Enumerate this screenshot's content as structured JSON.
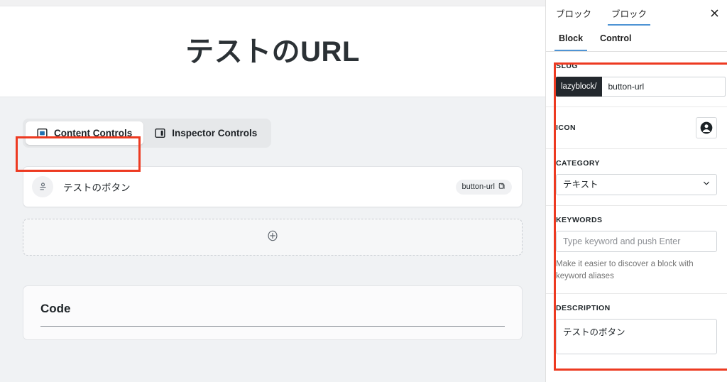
{
  "editor": {
    "page_title": "テストのURL",
    "control_tabs": [
      {
        "label": "Content Controls",
        "icon": "content-controls-icon",
        "active": true
      },
      {
        "label": "Inspector Controls",
        "icon": "inspector-controls-icon",
        "active": false
      }
    ],
    "control_row": {
      "icon": "button-control-icon",
      "label": "テストのボタン",
      "badge_label": "button-url",
      "badge_icon": "copy-icon"
    },
    "add_control": {
      "icon": "plus-circle-icon"
    },
    "code_section": {
      "title": "Code"
    }
  },
  "sidebar": {
    "header_tabs": [
      {
        "label": "ブロック",
        "active": false
      },
      {
        "label": "ブロック",
        "active": true
      }
    ],
    "close_label": "×",
    "sub_tabs": [
      {
        "label": "Block",
        "active": true
      },
      {
        "label": "Control",
        "active": false
      }
    ],
    "slug": {
      "label": "SLUG",
      "prefix": "lazyblock/",
      "value": "button-url",
      "placeholder": ""
    },
    "icon": {
      "label": "ICON",
      "glyph": "account-circle-icon"
    },
    "category": {
      "label": "CATEGORY",
      "value": "テキスト",
      "options": [
        "テキスト"
      ],
      "chevron": "chevron-down-icon"
    },
    "keywords": {
      "label": "KEYWORDS",
      "value": "",
      "placeholder": "Type keyword and push Enter",
      "help": "Make it easier to discover a block with keyword aliases"
    },
    "description": {
      "label": "DESCRIPTION",
      "value": "テストのボタン",
      "placeholder": ""
    }
  },
  "highlights": {
    "accent_color": "#ed3a21",
    "tabs_box": "content-controls-tab",
    "panel_box": "block-settings-panel"
  }
}
